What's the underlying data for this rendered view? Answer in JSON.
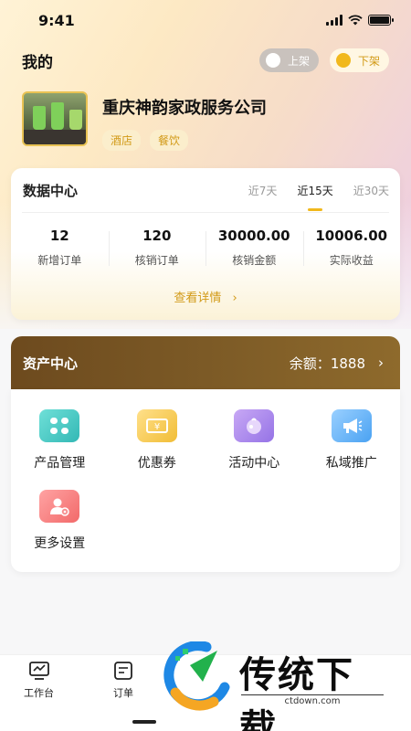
{
  "status_bar": {
    "time": "9:41"
  },
  "header": {
    "title": "我的",
    "toggle_on_shelf": "上架",
    "toggle_off_shelf": "下架"
  },
  "profile": {
    "company_name": "重庆神韵家政服务公司",
    "tags": [
      "酒店",
      "餐饮"
    ]
  },
  "data_center": {
    "title": "数据中心",
    "ranges": [
      "近7天",
      "近15天",
      "近30天"
    ],
    "active_range": "近15天",
    "stats": [
      {
        "value": "12",
        "label": "新增订单"
      },
      {
        "value": "120",
        "label": "核销订单"
      },
      {
        "value": "30000.00",
        "label": "核销金额"
      },
      {
        "value": "10006.00",
        "label": "实际收益"
      }
    ],
    "details_link": "查看详情"
  },
  "asset_center": {
    "title": "资产中心",
    "balance_label": "余额：",
    "balance_value": "1888",
    "items": [
      {
        "label": "产品管理",
        "icon": "product-grid-icon"
      },
      {
        "label": "优惠券",
        "icon": "coupon-icon"
      },
      {
        "label": "活动中心",
        "icon": "activity-icon"
      },
      {
        "label": "私域推广",
        "icon": "megaphone-icon"
      },
      {
        "label": "更多设置",
        "icon": "user-settings-icon"
      }
    ]
  },
  "tabbar": {
    "items": [
      {
        "label": "工作台",
        "icon": "workbench-icon"
      },
      {
        "label": "订单",
        "icon": "order-icon"
      }
    ]
  },
  "watermark": {
    "text": "传统下载",
    "url": "ctdown.com"
  },
  "colors": {
    "accent": "#f1b81c",
    "accent_text": "#d29a17",
    "asset_header": "#7c5a26"
  }
}
